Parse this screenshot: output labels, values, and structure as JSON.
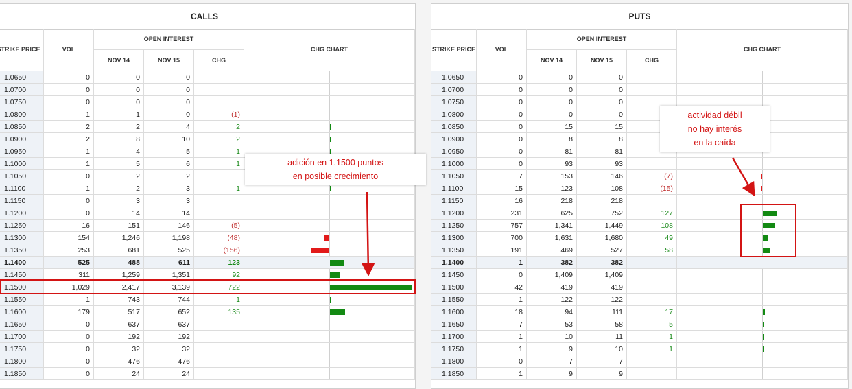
{
  "calls": {
    "title": "CALLS",
    "headers": {
      "strike": "STRIKE PRICE",
      "vol": "VOL",
      "open_interest": "OPEN INTEREST",
      "d1": "NOV 14",
      "d2": "NOV 15",
      "chg": "CHG",
      "chart": "CHG CHART"
    },
    "rows": [
      {
        "strike": "1.0650",
        "vol": "0",
        "oi1": "0",
        "oi2": "0",
        "chg": "",
        "chg_value": 0
      },
      {
        "strike": "1.0700",
        "vol": "0",
        "oi1": "0",
        "oi2": "0",
        "chg": "",
        "chg_value": 0
      },
      {
        "strike": "1.0750",
        "vol": "0",
        "oi1": "0",
        "oi2": "0",
        "chg": "",
        "chg_value": 0
      },
      {
        "strike": "1.0800",
        "vol": "1",
        "oi1": "1",
        "oi2": "0",
        "chg": "(1)",
        "chg_value": -1
      },
      {
        "strike": "1.0850",
        "vol": "2",
        "oi1": "2",
        "oi2": "4",
        "chg": "2",
        "chg_value": 2
      },
      {
        "strike": "1.0900",
        "vol": "2",
        "oi1": "8",
        "oi2": "10",
        "chg": "2",
        "chg_value": 2
      },
      {
        "strike": "1.0950",
        "vol": "1",
        "oi1": "4",
        "oi2": "5",
        "chg": "1",
        "chg_value": 1
      },
      {
        "strike": "1.1000",
        "vol": "1",
        "oi1": "5",
        "oi2": "6",
        "chg": "1",
        "chg_value": 1
      },
      {
        "strike": "1.1050",
        "vol": "0",
        "oi1": "2",
        "oi2": "2",
        "chg": "",
        "chg_value": 0
      },
      {
        "strike": "1.1100",
        "vol": "1",
        "oi1": "2",
        "oi2": "3",
        "chg": "1",
        "chg_value": 1
      },
      {
        "strike": "1.1150",
        "vol": "0",
        "oi1": "3",
        "oi2": "3",
        "chg": "",
        "chg_value": 0
      },
      {
        "strike": "1.1200",
        "vol": "0",
        "oi1": "14",
        "oi2": "14",
        "chg": "",
        "chg_value": 0
      },
      {
        "strike": "1.1250",
        "vol": "16",
        "oi1": "151",
        "oi2": "146",
        "chg": "(5)",
        "chg_value": -5
      },
      {
        "strike": "1.1300",
        "vol": "154",
        "oi1": "1,246",
        "oi2": "1,198",
        "chg": "(48)",
        "chg_value": -48
      },
      {
        "strike": "1.1350",
        "vol": "253",
        "oi1": "681",
        "oi2": "525",
        "chg": "(156)",
        "chg_value": -156
      },
      {
        "strike": "1.1400",
        "vol": "525",
        "oi1": "488",
        "oi2": "611",
        "chg": "123",
        "chg_value": 123,
        "bold": true
      },
      {
        "strike": "1.1450",
        "vol": "311",
        "oi1": "1,259",
        "oi2": "1,351",
        "chg": "92",
        "chg_value": 92
      },
      {
        "strike": "1.1500",
        "vol": "1,029",
        "oi1": "2,417",
        "oi2": "3,139",
        "chg": "722",
        "chg_value": 722
      },
      {
        "strike": "1.1550",
        "vol": "1",
        "oi1": "743",
        "oi2": "744",
        "chg": "1",
        "chg_value": 1
      },
      {
        "strike": "1.1600",
        "vol": "179",
        "oi1": "517",
        "oi2": "652",
        "chg": "135",
        "chg_value": 135
      },
      {
        "strike": "1.1650",
        "vol": "0",
        "oi1": "637",
        "oi2": "637",
        "chg": "",
        "chg_value": 0
      },
      {
        "strike": "1.1700",
        "vol": "0",
        "oi1": "192",
        "oi2": "192",
        "chg": "",
        "chg_value": 0
      },
      {
        "strike": "1.1750",
        "vol": "0",
        "oi1": "32",
        "oi2": "32",
        "chg": "",
        "chg_value": 0
      },
      {
        "strike": "1.1800",
        "vol": "0",
        "oi1": "476",
        "oi2": "476",
        "chg": "",
        "chg_value": 0
      },
      {
        "strike": "1.1850",
        "vol": "0",
        "oi1": "24",
        "oi2": "24",
        "chg": "",
        "chg_value": 0
      }
    ]
  },
  "puts": {
    "title": "PUTS",
    "headers": {
      "strike": "STRIKE PRICE",
      "vol": "VOL",
      "open_interest": "OPEN INTEREST",
      "d1": "NOV 14",
      "d2": "NOV 15",
      "chg": "CHG",
      "chart": "CHG CHART"
    },
    "rows": [
      {
        "strike": "1.0650",
        "vol": "0",
        "oi1": "0",
        "oi2": "0",
        "chg": "",
        "chg_value": 0
      },
      {
        "strike": "1.0700",
        "vol": "0",
        "oi1": "0",
        "oi2": "0",
        "chg": "",
        "chg_value": 0
      },
      {
        "strike": "1.0750",
        "vol": "0",
        "oi1": "0",
        "oi2": "0",
        "chg": "",
        "chg_value": 0
      },
      {
        "strike": "1.0800",
        "vol": "0",
        "oi1": "0",
        "oi2": "0",
        "chg": "",
        "chg_value": 0
      },
      {
        "strike": "1.0850",
        "vol": "0",
        "oi1": "15",
        "oi2": "15",
        "chg": "",
        "chg_value": 0
      },
      {
        "strike": "1.0900",
        "vol": "0",
        "oi1": "8",
        "oi2": "8",
        "chg": "",
        "chg_value": 0
      },
      {
        "strike": "1.0950",
        "vol": "0",
        "oi1": "81",
        "oi2": "81",
        "chg": "",
        "chg_value": 0
      },
      {
        "strike": "1.1000",
        "vol": "0",
        "oi1": "93",
        "oi2": "93",
        "chg": "",
        "chg_value": 0
      },
      {
        "strike": "1.1050",
        "vol": "7",
        "oi1": "153",
        "oi2": "146",
        "chg": "(7)",
        "chg_value": -7
      },
      {
        "strike": "1.1100",
        "vol": "15",
        "oi1": "123",
        "oi2": "108",
        "chg": "(15)",
        "chg_value": -15
      },
      {
        "strike": "1.1150",
        "vol": "16",
        "oi1": "218",
        "oi2": "218",
        "chg": "",
        "chg_value": 0
      },
      {
        "strike": "1.1200",
        "vol": "231",
        "oi1": "625",
        "oi2": "752",
        "chg": "127",
        "chg_value": 127
      },
      {
        "strike": "1.1250",
        "vol": "757",
        "oi1": "1,341",
        "oi2": "1,449",
        "chg": "108",
        "chg_value": 108
      },
      {
        "strike": "1.1300",
        "vol": "700",
        "oi1": "1,631",
        "oi2": "1,680",
        "chg": "49",
        "chg_value": 49
      },
      {
        "strike": "1.1350",
        "vol": "191",
        "oi1": "469",
        "oi2": "527",
        "chg": "58",
        "chg_value": 58
      },
      {
        "strike": "1.1400",
        "vol": "1",
        "oi1": "382",
        "oi2": "382",
        "chg": "",
        "chg_value": 0,
        "bold": true
      },
      {
        "strike": "1.1450",
        "vol": "0",
        "oi1": "1,409",
        "oi2": "1,409",
        "chg": "",
        "chg_value": 0
      },
      {
        "strike": "1.1500",
        "vol": "42",
        "oi1": "419",
        "oi2": "419",
        "chg": "",
        "chg_value": 0
      },
      {
        "strike": "1.1550",
        "vol": "1",
        "oi1": "122",
        "oi2": "122",
        "chg": "",
        "chg_value": 0
      },
      {
        "strike": "1.1600",
        "vol": "18",
        "oi1": "94",
        "oi2": "111",
        "chg": "17",
        "chg_value": 17
      },
      {
        "strike": "1.1650",
        "vol": "7",
        "oi1": "53",
        "oi2": "58",
        "chg": "5",
        "chg_value": 5
      },
      {
        "strike": "1.1700",
        "vol": "1",
        "oi1": "10",
        "oi2": "11",
        "chg": "1",
        "chg_value": 1
      },
      {
        "strike": "1.1750",
        "vol": "1",
        "oi1": "9",
        "oi2": "10",
        "chg": "1",
        "chg_value": 1
      },
      {
        "strike": "1.1800",
        "vol": "0",
        "oi1": "7",
        "oi2": "7",
        "chg": "",
        "chg_value": 0
      },
      {
        "strike": "1.1850",
        "vol": "1",
        "oi1": "9",
        "oi2": "9",
        "chg": "",
        "chg_value": 0
      }
    ]
  },
  "annotations": {
    "calls_note": "adición en 1.1500 puntos\nen posible crecimiento",
    "puts_note": "actividad débil\nno hay interés\nen la caída",
    "color": "#d31414"
  },
  "colors": {
    "positive_bar": "#138a13",
    "negative_bar": "#e21a1a",
    "positive_text": "#1a8a1a",
    "negative_text": "#c03030",
    "strike_bg": "#eef2f7"
  }
}
